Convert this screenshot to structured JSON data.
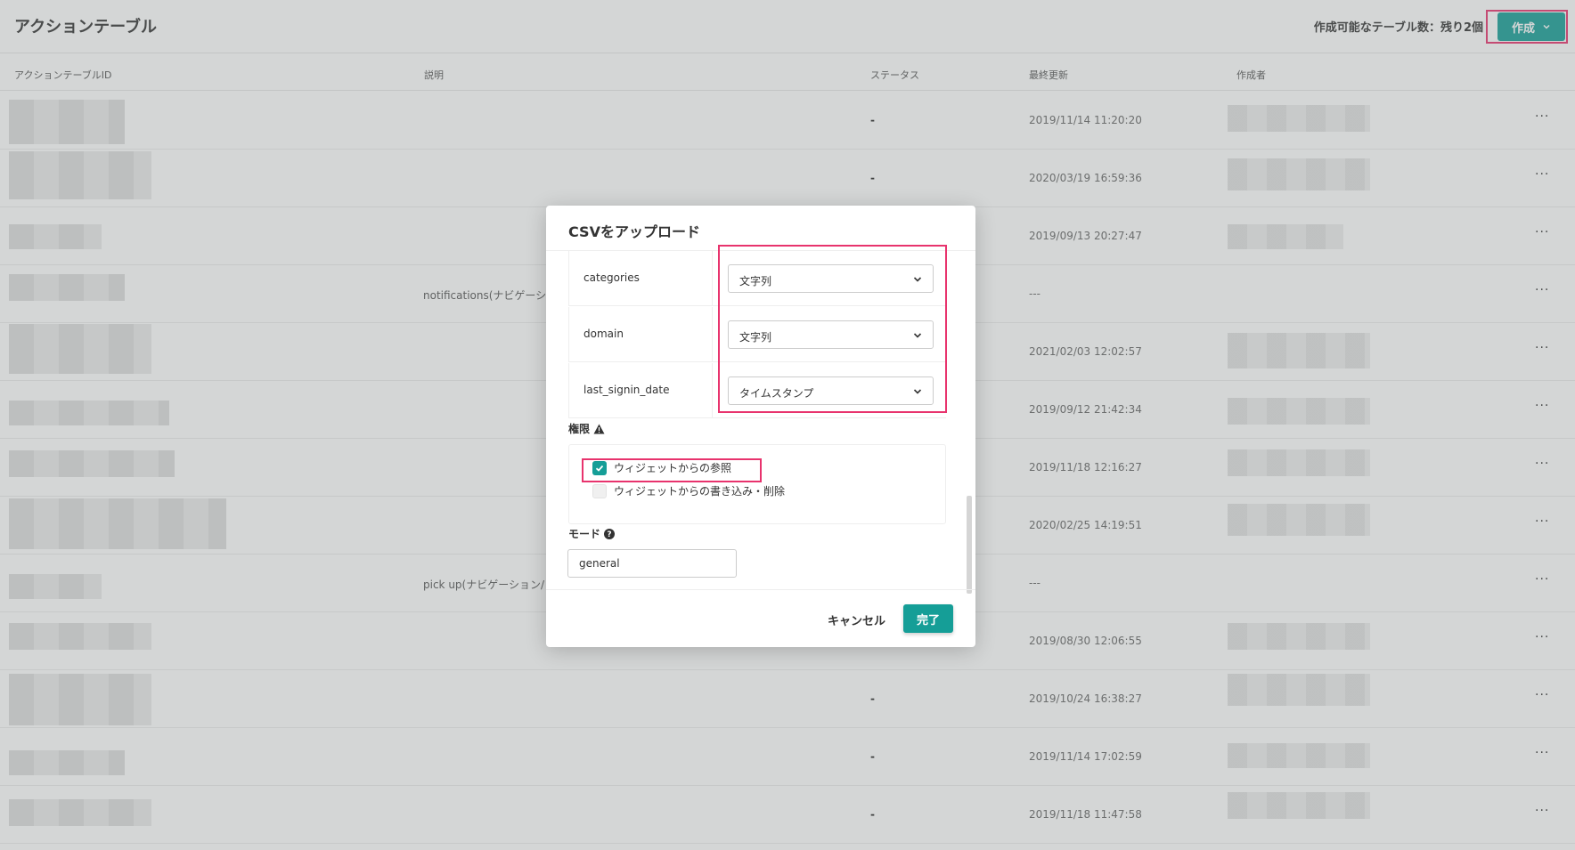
{
  "header": {
    "title": "アクションテーブル",
    "quota_text": "作成可能なテーブル数：残り2個",
    "create_label": "作成"
  },
  "table": {
    "columns": [
      "アクションテーブルID",
      "説明",
      "ステータス",
      "最終更新",
      "作成者"
    ],
    "rows": [
      {
        "description": "",
        "status": "-",
        "updated": "2019/11/14 11:20:20"
      },
      {
        "description": "",
        "status": "-",
        "updated": "2020/03/19 16:59:36"
      },
      {
        "description": "",
        "status": "",
        "updated": "2019/09/13 20:27:47"
      },
      {
        "description": "notifications(ナビゲーシ",
        "status": "",
        "updated": "---"
      },
      {
        "description": "",
        "status": "",
        "updated": "2021/02/03 12:02:57"
      },
      {
        "description": "",
        "status": "",
        "updated": "2019/09/12 21:42:34"
      },
      {
        "description": "",
        "status": "",
        "updated": "2019/11/18 12:16:27"
      },
      {
        "description": "",
        "status": "",
        "updated": "2020/02/25 14:19:51"
      },
      {
        "description": "pick up(ナビゲーション/",
        "status": "",
        "updated": "---"
      },
      {
        "description": "",
        "status": "",
        "updated": "2019/08/30 12:06:55"
      },
      {
        "description": "",
        "status": "-",
        "updated": "2019/10/24 16:38:27"
      },
      {
        "description": "",
        "status": "-",
        "updated": "2019/11/14 17:02:59"
      },
      {
        "description": "",
        "status": "-",
        "updated": "2019/11/18 11:47:58"
      }
    ],
    "more_label": "···"
  },
  "modal": {
    "title": "CSVをアップロード",
    "mappings": [
      {
        "column": "categories",
        "type": "文字列"
      },
      {
        "column": "domain",
        "type": "文字列"
      },
      {
        "column": "last_signin_date",
        "type": "タイムスタンプ"
      }
    ],
    "permissions_label": "権限",
    "permissions": [
      {
        "label": "ウィジェットからの参照",
        "checked": true
      },
      {
        "label": "ウィジェットからの書き込み・削除",
        "checked": false
      }
    ],
    "mode_label": "モード",
    "mode_value": "general",
    "cancel_label": "キャンセル",
    "done_label": "完了"
  },
  "colors": {
    "accent": "#159e97",
    "highlight": "#e8336d"
  }
}
